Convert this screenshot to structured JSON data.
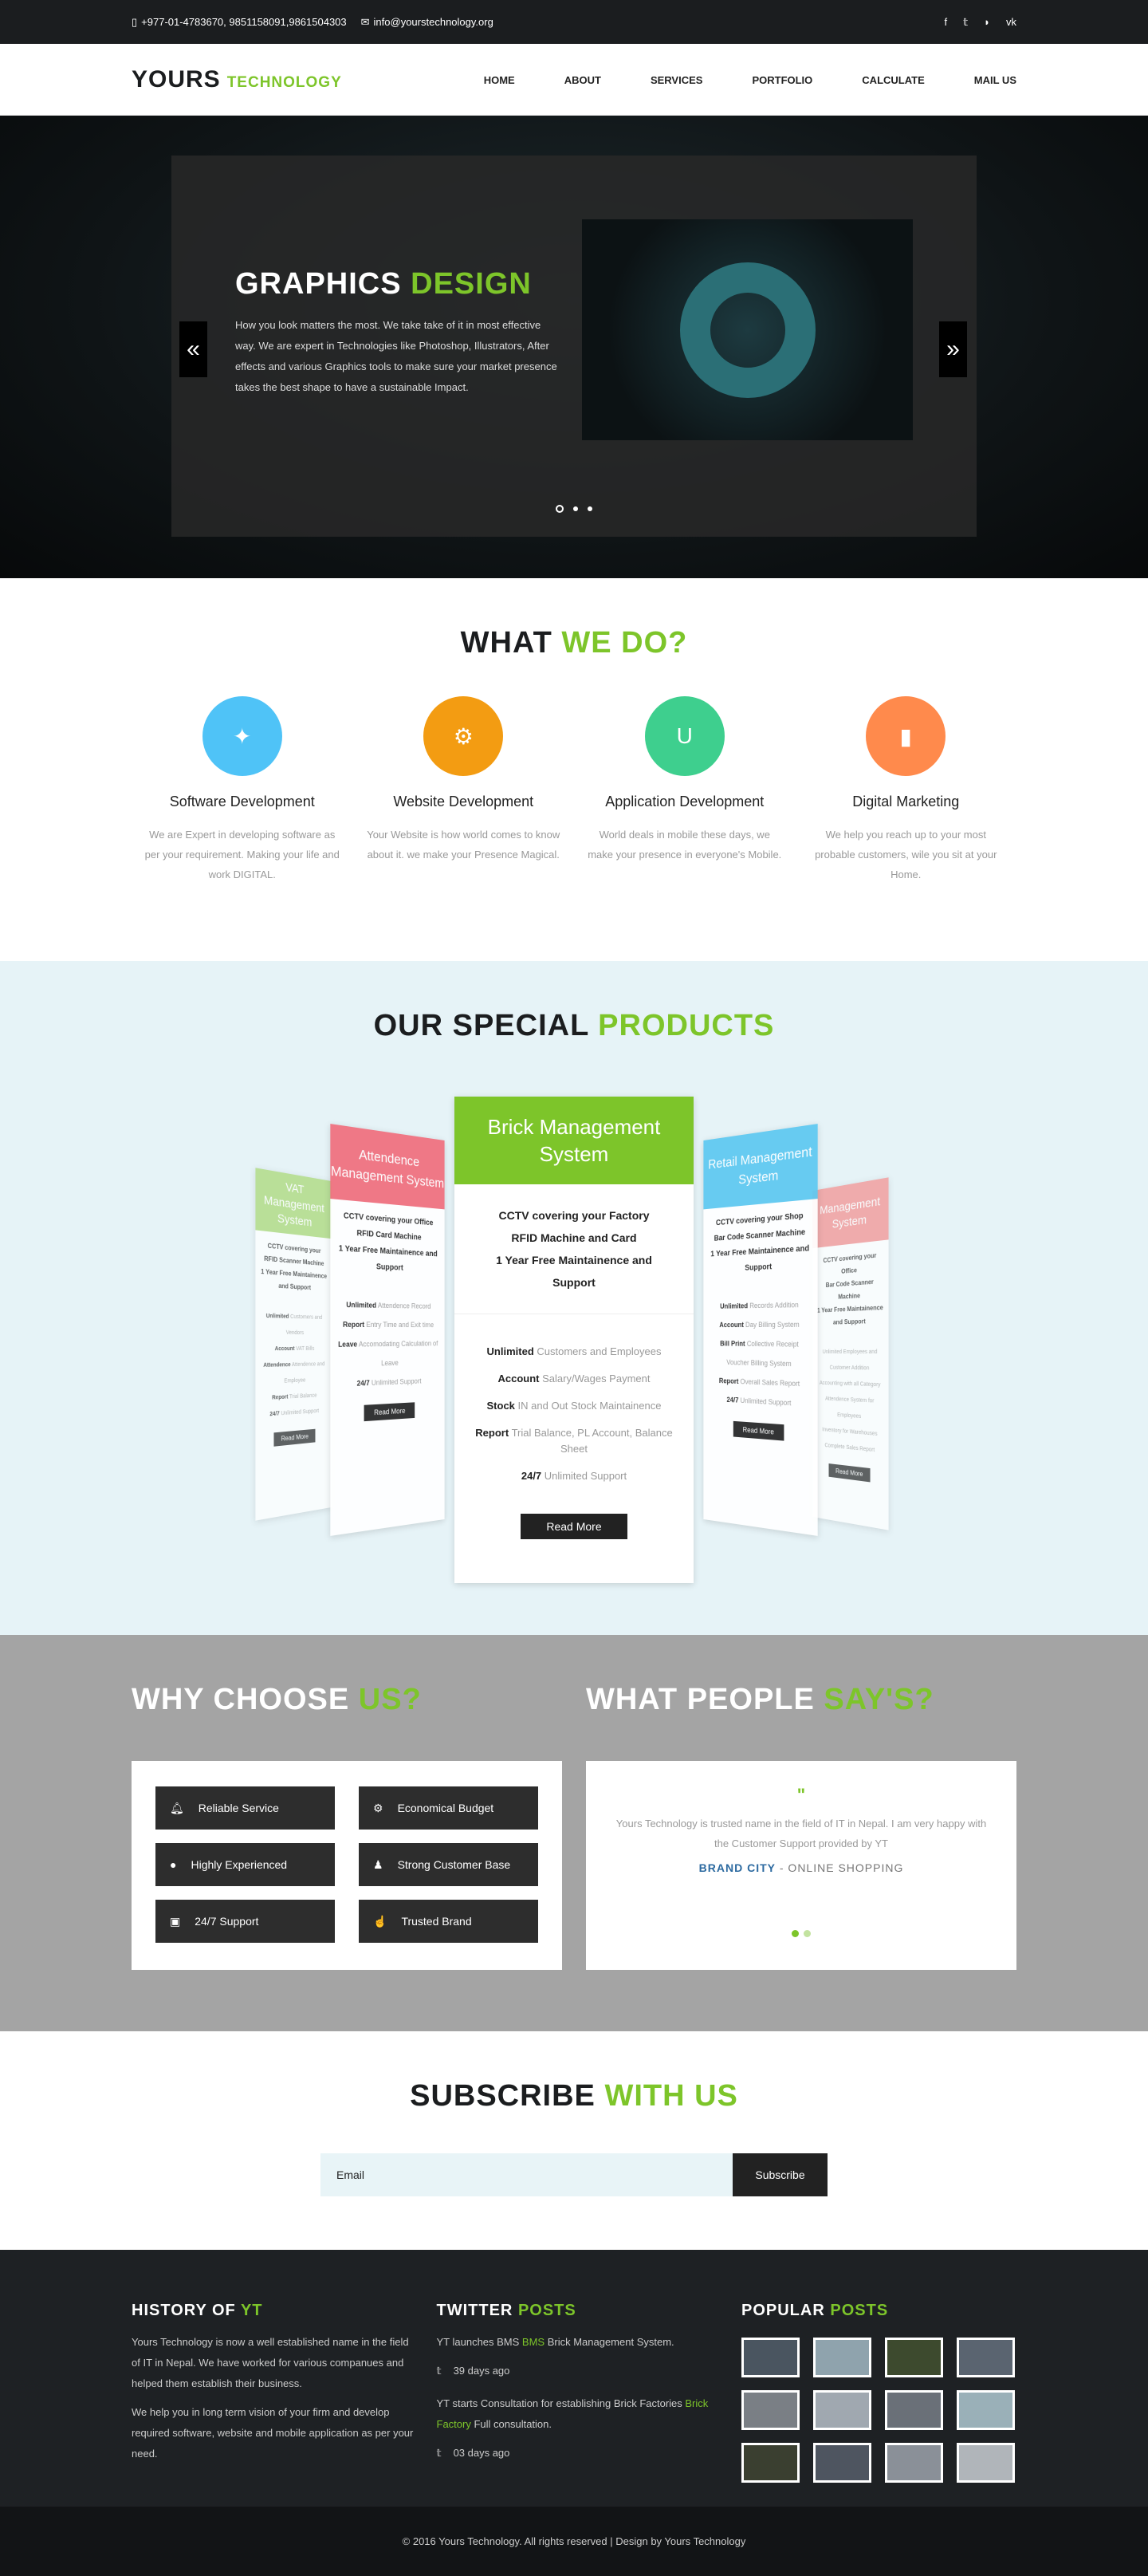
{
  "topbar": {
    "phone": "+977-01-4783670, 9851158091,9861504303",
    "email": "info@yourstechnology.org",
    "social": [
      "f",
      "t",
      "rss",
      "vk"
    ]
  },
  "header": {
    "logo_main": "YOURS",
    "logo_sub": "TECHNOLOGY",
    "nav": [
      "HOME",
      "ABOUT",
      "SERVICES",
      "PORTFOLIO",
      "CALCULATE",
      "MAIL US"
    ]
  },
  "hero": {
    "title_a": "GRAPHICS",
    "title_b": "DESIGN",
    "text": "How you look matters the most. We take take of it in most effective way. We are expert in Technologies like Photoshop, Illustrators, After effects and various Graphics tools to make sure your market presence takes the best shape to have a sustainable Impact.",
    "prev": "«",
    "next": "»"
  },
  "wwd": {
    "title_a": "WHAT",
    "title_b": "WE DO?",
    "items": [
      {
        "title": "Software Development",
        "text": "We are Expert in developing software as per your requirement. Making your life and work DIGITAL.",
        "color": "#4fc3f7",
        "icon": "✦"
      },
      {
        "title": "Website Development",
        "text": "Your Website is how world comes to know about it. we make your Presence Magical.",
        "color": "#f39c12",
        "icon": "⚙"
      },
      {
        "title": "Application Development",
        "text": "World deals in mobile these days, we make your presence in everyone's Mobile.",
        "color": "#3ecf8e",
        "icon": "U"
      },
      {
        "title": "Digital Marketing",
        "text": "We help you reach up to your most probable customers, wile you sit at your Home.",
        "color": "#ff8a4c",
        "icon": "▮"
      }
    ]
  },
  "products": {
    "title_a": "OUR SPECIAL",
    "title_b": "PRODUCTS",
    "main": {
      "head": "Brick Management System",
      "feat": [
        "CCTV covering your Factory",
        "RFID Machine and Card",
        "1 Year Free Maintainence and Support"
      ],
      "list": [
        [
          "Unlimited",
          "Customers and Employees"
        ],
        [
          "Account",
          "Salary/Wages Payment"
        ],
        [
          "Stock",
          "IN and Out Stock Maintainence"
        ],
        [
          "Report",
          "Trial Balance, PL Account, Balance Sheet"
        ],
        [
          "24/7",
          "Unlimited Support"
        ]
      ],
      "btn": "Read More"
    },
    "l1": {
      "head": "Attendence Management System",
      "feat": [
        "CCTV covering your Office",
        "RFID Card Machine",
        "1 Year Free Maintainence and Support"
      ],
      "list": [
        [
          "Unlimited",
          "Attendence Record"
        ],
        [
          "Report",
          "Entry Time and Exit time"
        ],
        [
          "Leave",
          "Accomodating Calculation of Leave"
        ],
        [
          "24/7",
          "Unlimited Support"
        ]
      ],
      "btn": "Read More"
    },
    "r1": {
      "head": "Retail Management System",
      "feat": [
        "CCTV covering your Shop",
        "Bar Code Scanner Machine",
        "1 Year Free Maintainence and Support"
      ],
      "list": [
        [
          "Unlimited",
          "Records Addition"
        ],
        [
          "Account",
          "Day Billing System"
        ],
        [
          "Bill Print",
          "Collective Receipt Voucher Billing System"
        ],
        [
          "Report",
          "Overall Sales Report"
        ],
        [
          "24/7",
          "Unlimited Support"
        ]
      ],
      "btn": "Read More"
    },
    "l2": {
      "head": "VAT Management System",
      "feat": [
        "CCTV covering your",
        "RFID Scanner Machine",
        "1 Year Free Maintainence and Support"
      ],
      "list": [
        [
          "Unlimited",
          "Customers and Vendors"
        ],
        [
          "Account",
          "VAT Bills"
        ],
        [
          "Attendence",
          "Attendence and Employee"
        ],
        [
          "Report",
          "Trial Balance"
        ],
        [
          "24/7",
          "Unlimited Support"
        ]
      ],
      "btn": "Read More"
    },
    "r2": {
      "head": "Management System",
      "feat": [
        "CCTV covering your Office",
        "Bar Code Scanner Machine",
        "1 Year Free Maintainence and Support"
      ],
      "list": [
        [
          "",
          "Unlimited Employees and Customer Addition"
        ],
        [
          "",
          "Accounting with all Category"
        ],
        [
          "",
          "Attendence System for Employees"
        ],
        [
          "",
          "Inventory for Warehouses"
        ],
        [
          "",
          "Complete Sales Report"
        ]
      ],
      "btn": "Read More"
    }
  },
  "why": {
    "title_a": "WHY CHOOSE",
    "title_b": "US?",
    "features": [
      [
        "Reliable Service",
        "bell-icon"
      ],
      [
        "Economical Budget",
        "gear-icon"
      ],
      [
        "Highly Experienced",
        "comments-icon"
      ],
      [
        "Strong Customer Base",
        "user-icon"
      ],
      [
        "24/7 Support",
        "money-icon"
      ],
      [
        "Trusted Brand",
        "thumbs-up-icon"
      ]
    ]
  },
  "people": {
    "title_a": "WHAT PEOPLE",
    "title_b": "SAY'S?",
    "quote": "Yours Technology is trusted name in the field of IT in Nepal. I am very happy with the Customer Support provided by YT",
    "brand": "BRAND CITY",
    "role": " - ONLINE SHOPPING"
  },
  "subscribe": {
    "title_a": "SUBSCRIBE",
    "title_b": "WITH US",
    "placeholder": "Email",
    "btn": "Subscribe"
  },
  "footer": {
    "h1_a": "HISTORY OF",
    "h1_b": "YT",
    "p1": "Yours Technology is now a well established name in the field of IT in Nepal. We have worked for various companues and helped them establish their business.",
    "p2": "We help you in long term vision of your firm and develop required software, website and mobile application as per your need.",
    "h2_a": "TWITTER",
    "h2_b": "POSTS",
    "tw1_a": "YT launches BMS ",
    "tw1_b": "BMS",
    "tw1_c": " Brick Management System.",
    "tw1_date": "39 days ago",
    "tw2_a": "YT starts Consultation for establishing Brick Factories ",
    "tw2_b": "Brick Factory",
    "tw2_c": " Full consultation.",
    "tw2_date": "03 days ago",
    "h3_a": "POPULAR",
    "h3_b": "POSTS",
    "copyright": "© 2016 Yours Technology. All rights reserved | Design by Yours Technology"
  }
}
